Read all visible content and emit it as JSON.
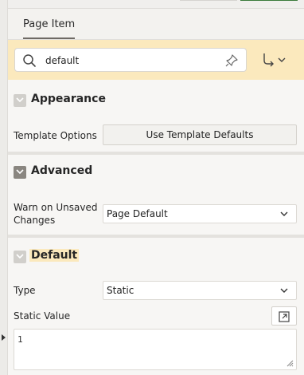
{
  "tabs": [
    {
      "label": "Page Item"
    }
  ],
  "search": {
    "value": "default",
    "search_icon": "search-icon",
    "pin_icon": "pin-icon",
    "goto_icon": "goto-component-icon"
  },
  "sections": {
    "appearance": {
      "title": "Appearance",
      "template_options_label": "Template Options",
      "template_options_button": "Use Template Defaults"
    },
    "advanced": {
      "title": "Advanced",
      "warn_label": "Warn on Unsaved Changes",
      "warn_value": "Page Default"
    },
    "default": {
      "title": "Default",
      "type_label": "Type",
      "type_value": "Static",
      "static_value_label": "Static Value",
      "static_value": "1"
    }
  },
  "colors": {
    "highlight": "#fbe9bd",
    "background": "#f7f6f4"
  }
}
